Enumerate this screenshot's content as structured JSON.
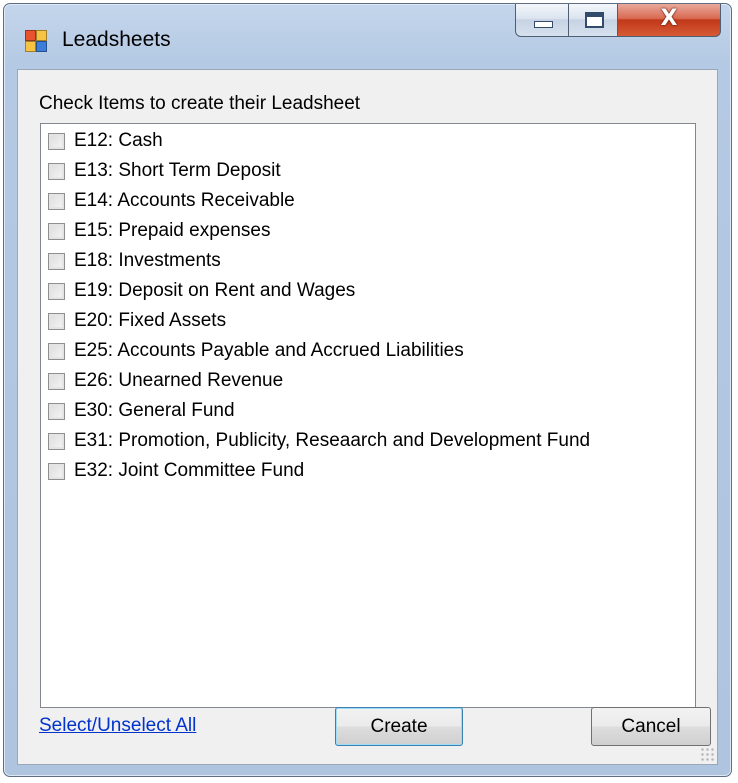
{
  "window": {
    "title": "Leadsheets",
    "close_glyph": "X"
  },
  "dialog": {
    "instruction": "Check Items to create their Leadsheet",
    "items": [
      {
        "label": "E12: Cash",
        "checked": false
      },
      {
        "label": "E13: Short Term Deposit",
        "checked": false
      },
      {
        "label": "E14: Accounts Receivable",
        "checked": false
      },
      {
        "label": "E15: Prepaid expenses",
        "checked": false
      },
      {
        "label": "E18: Investments",
        "checked": false
      },
      {
        "label": "E19: Deposit on Rent and Wages",
        "checked": false
      },
      {
        "label": "E20: Fixed Assets",
        "checked": false
      },
      {
        "label": "E25: Accounts Payable and Accrued Liabilities",
        "checked": false
      },
      {
        "label": "E26: Unearned Revenue",
        "checked": false
      },
      {
        "label": "E30: General Fund",
        "checked": false
      },
      {
        "label": "E31: Promotion, Publicity, Reseaarch and Development Fund",
        "checked": false
      },
      {
        "label": "E32: Joint Committee Fund",
        "checked": false
      }
    ],
    "select_all_link": "Select/Unselect All",
    "create_label": "Create",
    "cancel_label": "Cancel"
  },
  "icons": {
    "app": "app-icon",
    "minimize": "minimize-icon",
    "maximize": "maximize-icon",
    "close": "close-icon",
    "grip": "resize-grip-icon"
  },
  "colors": {
    "link": "#0033cc",
    "close_button": "#c2381b",
    "default_button_border": "#3c7fb1"
  }
}
